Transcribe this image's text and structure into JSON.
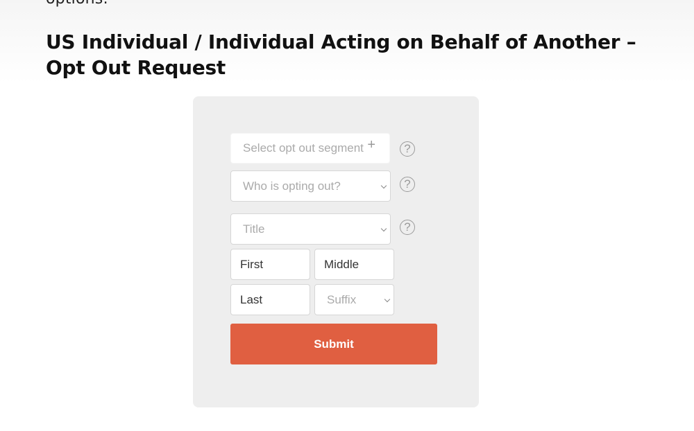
{
  "intro": {
    "text": "options:"
  },
  "heading": {
    "text": "US Individual / Individual Acting on Behalf of Another – Opt Out Request"
  },
  "form": {
    "segment": {
      "placeholder": "Select opt out segment",
      "icon": "plus-icon",
      "glyph": "+"
    },
    "who": {
      "placeholder": "Who is opting out?"
    },
    "title": {
      "placeholder": "Title"
    },
    "first": {
      "value": "First"
    },
    "middle": {
      "value": "Middle"
    },
    "last": {
      "value": "Last"
    },
    "suffix": {
      "placeholder": "Suffix"
    },
    "help": {
      "glyph": "?"
    },
    "submit": {
      "label": "Submit"
    }
  },
  "colors": {
    "panel_background": "#eeeeee",
    "submit_background": "#e05f41",
    "placeholder_text": "#aaaaaa"
  }
}
